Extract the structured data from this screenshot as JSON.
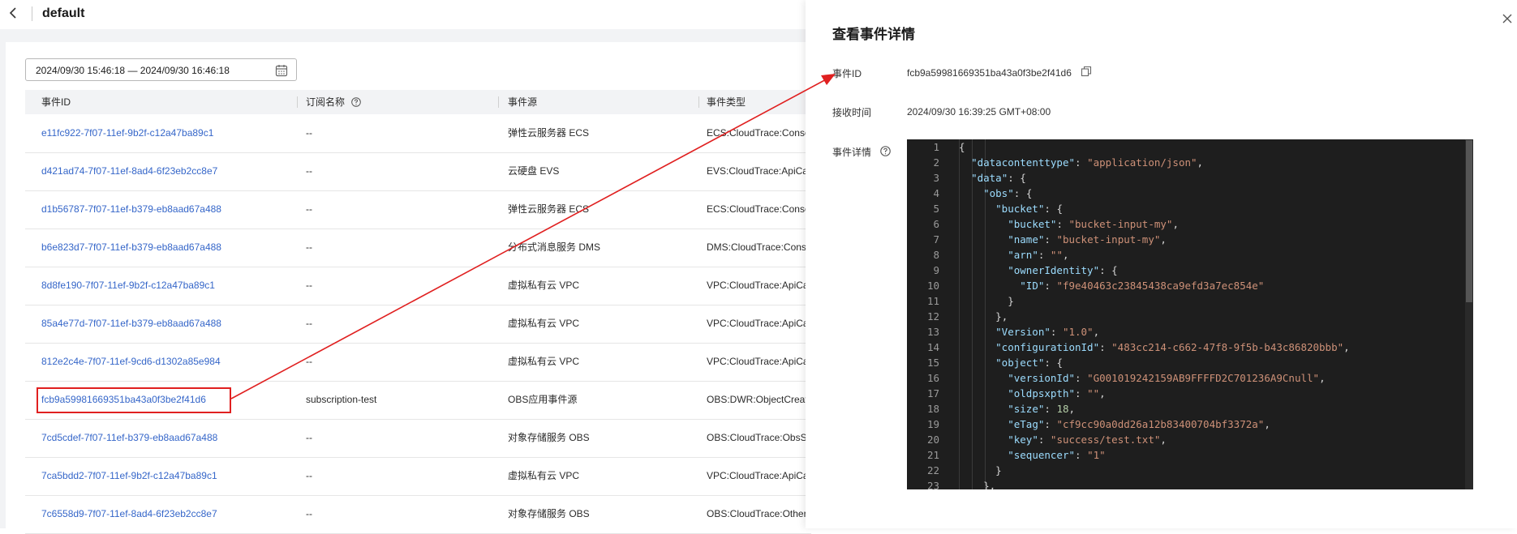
{
  "header": {
    "title": "default"
  },
  "filter": {
    "date_range": "2024/09/30 15:46:18 — 2024/09/30 16:46:18"
  },
  "table": {
    "columns": [
      "事件ID",
      "订阅名称",
      "事件源",
      "事件类型"
    ],
    "rows": [
      {
        "id": "e11fc922-7f07-11ef-9b2f-c12a47ba89c1",
        "subscription": "--",
        "source": "弹性云服务器 ECS",
        "type": "ECS:CloudTrace:Conso"
      },
      {
        "id": "d421ad74-7f07-11ef-8ad4-6f23eb2cc8e7",
        "subscription": "--",
        "source": "云硬盘 EVS",
        "type": "EVS:CloudTrace:ApiCal"
      },
      {
        "id": "d1b56787-7f07-11ef-b379-eb8aad67a488",
        "subscription": "--",
        "source": "弹性云服务器 ECS",
        "type": "ECS:CloudTrace:Conso"
      },
      {
        "id": "b6e823d7-7f07-11ef-b379-eb8aad67a488",
        "subscription": "--",
        "source": "分布式消息服务 DMS",
        "type": "DMS:CloudTrace:Conso"
      },
      {
        "id": "8d8fe190-7f07-11ef-9b2f-c12a47ba89c1",
        "subscription": "--",
        "source": "虚拟私有云 VPC",
        "type": "VPC:CloudTrace:ApiCal"
      },
      {
        "id": "85a4e77d-7f07-11ef-b379-eb8aad67a488",
        "subscription": "--",
        "source": "虚拟私有云 VPC",
        "type": "VPC:CloudTrace:ApiCal"
      },
      {
        "id": "812e2c4e-7f07-11ef-9cd6-d1302a85e984",
        "subscription": "--",
        "source": "虚拟私有云 VPC",
        "type": "VPC:CloudTrace:ApiCal"
      },
      {
        "id": "fcb9a59981669351ba43a0f3be2f41d6",
        "subscription": "subscription-test",
        "source": "OBS应用事件源",
        "type": "OBS:DWR:ObjectCreate"
      },
      {
        "id": "7cd5cdef-7f07-11ef-b379-eb8aad67a488",
        "subscription": "--",
        "source": "对象存储服务 OBS",
        "type": "OBS:CloudTrace:ObsSD"
      },
      {
        "id": "7ca5bdd2-7f07-11ef-9b2f-c12a47ba89c1",
        "subscription": "--",
        "source": "虚拟私有云 VPC",
        "type": "VPC:CloudTrace:ApiCal"
      },
      {
        "id": "7c6558d9-7f07-11ef-8ad4-6f23eb2cc8e7",
        "subscription": "--",
        "source": "对象存储服务 OBS",
        "type": "OBS:CloudTrace:Others"
      }
    ]
  },
  "drawer": {
    "title": "查看事件详情",
    "event_id_label": "事件ID",
    "event_id": "fcb9a59981669351ba43a0f3be2f41d6",
    "received_label": "接收时间",
    "received_time": "2024/09/30 16:39:25 GMT+08:00",
    "detail_label": "事件详情",
    "code_lines": [
      "{",
      "  \"datacontenttype\": \"application/json\",",
      "  \"data\": {",
      "    \"obs\": {",
      "      \"bucket\": {",
      "        \"bucket\": \"bucket-input-my\",",
      "        \"name\": \"bucket-input-my\",",
      "        \"arn\": \"\",",
      "        \"ownerIdentity\": {",
      "          \"ID\": \"f9e40463c23845438ca9efd3a7ec854e\"",
      "        }",
      "      },",
      "      \"Version\": \"1.0\",",
      "      \"configurationId\": \"483cc214-c662-47f8-9f5b-b43c86820bbb\",",
      "      \"object\": {",
      "        \"versionId\": \"G001019242159AB9FFFFD2C701236A9Cnull\",",
      "        \"oldpsxpth\": \"\",",
      "        \"size\": 18,",
      "        \"eTag\": \"cf9cc90a0dd26a12b83400704bf3372a\",",
      "        \"key\": \"success/test.txt\",",
      "        \"sequencer\": \"1\"",
      "      }",
      "    },"
    ]
  },
  "colors": {
    "link": "#3566c9",
    "highlight": "#e02020",
    "code_bg": "#1e1e1e"
  }
}
